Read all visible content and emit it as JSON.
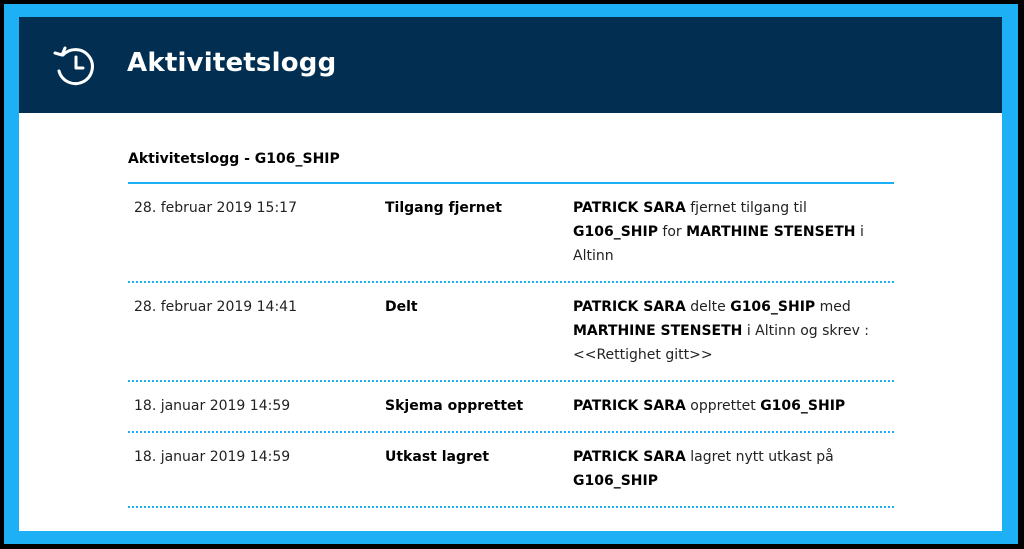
{
  "header": {
    "title": "Aktivitetslogg",
    "icon": "history-icon"
  },
  "log": {
    "title": "Aktivitetslogg - G106_SHIP",
    "rows": [
      {
        "time": "28. februar 2019 15:17",
        "action": "Tilgang fjernet",
        "desc": [
          {
            "text": "PATRICK SARA",
            "bold": true
          },
          {
            "text": " fjernet tilgang til ",
            "bold": false
          },
          {
            "text": "G106_SHIP",
            "bold": true
          },
          {
            "text": " for ",
            "bold": false
          },
          {
            "text": "MARTHINE STENSETH",
            "bold": true
          },
          {
            "text": " i Altinn",
            "bold": false
          }
        ]
      },
      {
        "time": "28. februar 2019 14:41",
        "action": "Delt",
        "desc": [
          {
            "text": "PATRICK SARA",
            "bold": true
          },
          {
            "text": " delte ",
            "bold": false
          },
          {
            "text": "G106_SHIP",
            "bold": true
          },
          {
            "text": " med ",
            "bold": false
          },
          {
            "text": "MARTHINE STENSETH",
            "bold": true
          },
          {
            "text": " i Altinn og skrev : <<Rettighet gitt>>",
            "bold": false
          }
        ]
      },
      {
        "time": "18. januar 2019 14:59",
        "action": "Skjema opprettet",
        "desc": [
          {
            "text": "PATRICK SARA",
            "bold": true
          },
          {
            "text": " opprettet ",
            "bold": false
          },
          {
            "text": "G106_SHIP",
            "bold": true
          }
        ]
      },
      {
        "time": "18. januar 2019 14:59",
        "action": "Utkast lagret",
        "desc": [
          {
            "text": "PATRICK SARA",
            "bold": true
          },
          {
            "text": " lagret nytt utkast på ",
            "bold": false
          },
          {
            "text": "G106_SHIP",
            "bold": true
          }
        ]
      }
    ]
  },
  "colors": {
    "header_bg": "#022f51",
    "accent": "#1eb0f5",
    "text": "#000000"
  }
}
